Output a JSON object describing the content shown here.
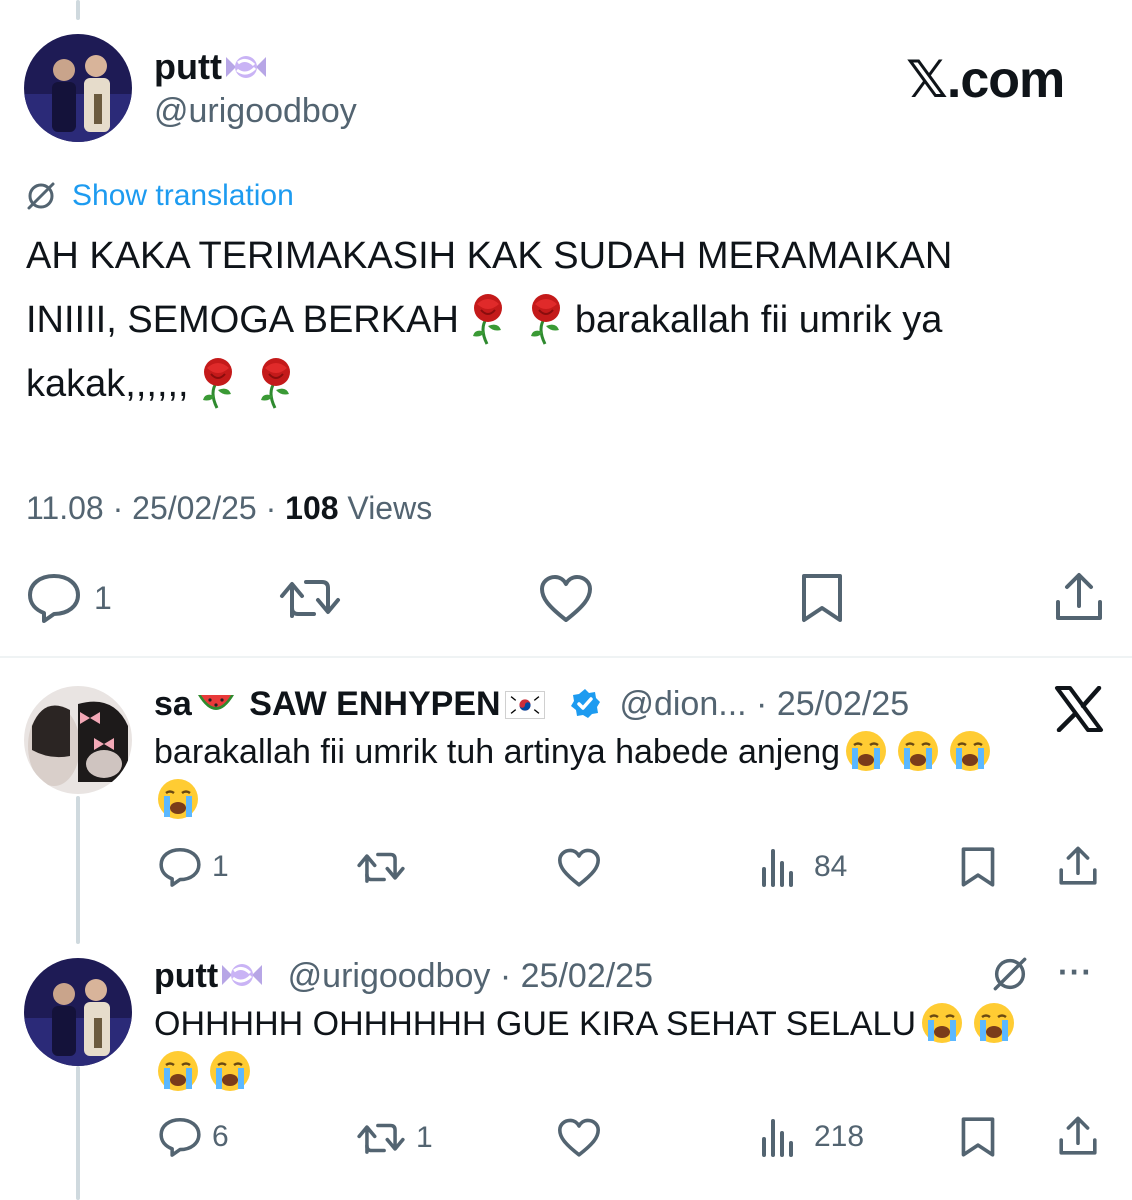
{
  "main_tweet": {
    "author_name": "putt",
    "author_handle": "@urigoodboy",
    "brand": "𝕏.com",
    "translate_label": "Show translation",
    "text_line1": "AH KAKA TERIMAKASIH KAK SUDAH MERAMAIKAN",
    "text_line2a": "INIIII, SEMOGA BERKAH",
    "text_line2b": "barakallah fii umrik ya",
    "text_line3": "kakak,,,,,,",
    "time": "11.08",
    "date": "25/02/25",
    "views_count": "108",
    "views_label": "Views",
    "reply_count": "1"
  },
  "reply1": {
    "author_name_a": "sa",
    "author_name_b": "SAW ENHYPEN",
    "author_handle": "@dion...",
    "date": "25/02/25",
    "text_line1": "barakallah fii umrik tuh artinya habede anjeng",
    "reply_count": "1",
    "views_count": "84"
  },
  "reply2": {
    "author_name": "putt",
    "author_handle": "@urigoodboy",
    "date": "25/02/25",
    "text_line1": "OHHHHH OHHHHHH GUE KIRA SEHAT SELALU",
    "reply_count": "6",
    "repost_count": "1",
    "views_count": "218",
    "more_label": "···"
  },
  "separator": "·",
  "colors": {
    "text": "#0f1419",
    "muted": "#536471",
    "accent": "#1d9bf0",
    "divider": "#eff3f4",
    "thread_line": "#cfd9de"
  }
}
